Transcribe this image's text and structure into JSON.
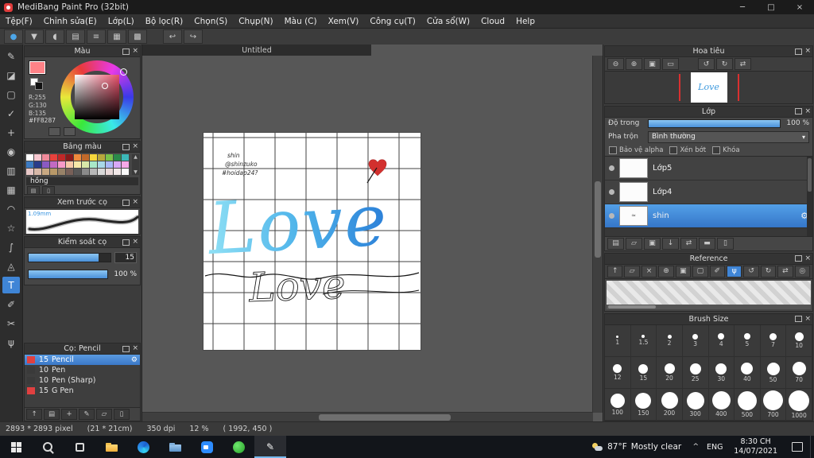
{
  "titlebar": {
    "title": "MediBang Paint Pro (32bit)",
    "minimize": "─",
    "maximize": "□",
    "close": "×"
  },
  "menubar": {
    "items": [
      "Tệp(F)",
      "Chỉnh sửa(E)",
      "Lớp(L)",
      "Bộ lọc(R)",
      "Chọn(S)",
      "Chụp(N)",
      "Màu (C)",
      "Xem(V)",
      "Công cụ(T)",
      "Cửa sổ(W)",
      "Cloud",
      "Help"
    ]
  },
  "toolbar": {
    "icons": [
      {
        "name": "brush-dot-icon",
        "glyph": "●",
        "color": "#4da6e8"
      },
      {
        "name": "save-icon",
        "glyph": "▼"
      },
      {
        "name": "comment-icon",
        "glyph": "◖"
      },
      {
        "name": "material-panel-icon",
        "glyph": "▤"
      },
      {
        "name": "list-view-icon",
        "glyph": "≡"
      },
      {
        "name": "grid-view-icon",
        "glyph": "▦"
      },
      {
        "name": "table-view-icon",
        "glyph": "▩"
      }
    ],
    "undo_glyph": "↩",
    "redo_glyph": "↪"
  },
  "toolstrip": {
    "tools": [
      {
        "name": "brush-tool",
        "glyph": "✎",
        "active": false
      },
      {
        "name": "eraser-tool",
        "glyph": "◪",
        "active": false
      },
      {
        "name": "select-rect-tool",
        "glyph": "▢",
        "active": false
      },
      {
        "name": "select-pen-tool",
        "glyph": "✓",
        "active": false
      },
      {
        "name": "move-tool",
        "glyph": "+",
        "active": false
      },
      {
        "name": "bucket-tool",
        "glyph": "◉",
        "active": false
      },
      {
        "name": "gradient-tool",
        "glyph": "▥",
        "active": false
      },
      {
        "name": "marquee-tool",
        "glyph": "▦",
        "active": false
      },
      {
        "name": "lasso-tool",
        "glyph": "◠",
        "active": false
      },
      {
        "name": "magic-wand-tool",
        "glyph": "☆",
        "active": false
      },
      {
        "name": "curve-tool",
        "glyph": "∫",
        "active": false
      },
      {
        "name": "shape-tool",
        "glyph": "◬",
        "active": false
      },
      {
        "name": "text-tool",
        "glyph": "T",
        "active": true
      },
      {
        "name": "pipette-tool",
        "glyph": "✐",
        "active": false
      },
      {
        "name": "divide-tool",
        "glyph": "✂",
        "active": false
      },
      {
        "name": "hand-tool",
        "glyph": "ψ",
        "active": false
      }
    ]
  },
  "color_panel": {
    "title": "Màu",
    "r_label": "R:255",
    "g_label": "G:130",
    "b_label": "B:135",
    "hex": "#FF8287",
    "fg_color": "#FF8287"
  },
  "palette_panel": {
    "title": "Bảng màu",
    "selected_name": "hồng",
    "up": "▲",
    "down": "▼",
    "colors": [
      "#ffffff",
      "#f7c8d0",
      "#f08a9a",
      "#e8413c",
      "#c22828",
      "#8a1a1a",
      "#f08a3c",
      "#c2692a",
      "#f7d83c",
      "#b8a83c",
      "#7ac24a",
      "#2a8a4a",
      "#3cb8b8",
      "#3c7ac2",
      "#2a3c8a",
      "#8a5ac2",
      "#c26ac2",
      "#f79ac8",
      "#f7c8a8",
      "#f7e8a8",
      "#d8e8a8",
      "#a8e8c8",
      "#a8d8e8",
      "#a8b8f7",
      "#d8a8f7",
      "#f7a8e8",
      "#e8c8c8",
      "#d8b8a8",
      "#c8a882",
      "#b89868",
      "#988268",
      "#786058",
      "#585858",
      "#8a8a8a",
      "#b8b8b8",
      "#d8d8d8",
      "#e8d8d8",
      "#f2e8e8",
      "#fafafa"
    ]
  },
  "brush_preview_panel": {
    "title": "Xem trước cọ",
    "size_label": "1.09mm"
  },
  "brush_control_panel": {
    "title": "Kiểm soát cọ",
    "size_value": "15",
    "size_fill": "85%",
    "opacity_value": "100 %",
    "opacity_fill": "100%"
  },
  "brush_list_panel": {
    "title": "Cọ: Pencil",
    "gear_glyph": "⚙",
    "brushes": [
      {
        "size": "15",
        "name": "Pencil",
        "chip": "#e04040",
        "selected": true
      },
      {
        "size": "10",
        "name": "Pen",
        "chip": "#3a3a3a",
        "selected": false
      },
      {
        "size": "10",
        "name": "Pen (Sharp)",
        "chip": "#3a3a3a",
        "selected": false
      },
      {
        "size": "15",
        "name": "G Pen",
        "chip": "#e04040",
        "selected": false
      }
    ],
    "footer_icons": [
      {
        "name": "scroll-up-icon",
        "glyph": "↑"
      },
      {
        "name": "new-brush-icon",
        "glyph": "▤"
      },
      {
        "name": "add-brush-icon",
        "glyph": "+"
      },
      {
        "name": "edit-brush-icon",
        "glyph": "✎"
      },
      {
        "name": "brush-folder-icon",
        "glyph": "▱"
      },
      {
        "name": "delete-brush-icon",
        "glyph": "▯"
      }
    ]
  },
  "canvas": {
    "tab": "Untitled",
    "note_line1": "shin",
    "note_line2": "@shinzuko",
    "note_line3": "#hoidap24?",
    "word_main": "Love",
    "word_script": "Love"
  },
  "navigator_panel": {
    "title": "Hoa tiêu",
    "icons": [
      {
        "name": "nav-zoom-out-icon",
        "glyph": "⊖"
      },
      {
        "name": "nav-zoom-in-icon",
        "glyph": "⊕"
      },
      {
        "name": "nav-fit-icon",
        "glyph": "▣"
      },
      {
        "name": "nav-actual-size-icon",
        "glyph": "▭"
      },
      {
        "name": "nav-rotate-left-icon",
        "glyph": "↺"
      },
      {
        "name": "nav-rotate-right-icon",
        "glyph": "↻"
      },
      {
        "name": "nav-flip-icon",
        "glyph": "⇄"
      }
    ]
  },
  "layers_panel": {
    "title": "Lớp",
    "opacity_label": "Độ trong",
    "opacity_value": "100 %",
    "opacity_fill": "100%",
    "blend_label": "Pha trộn",
    "blend_value": "Bình thường",
    "blend_arrow": "▾",
    "alpha_check": "Bảo vệ alpha",
    "clip_check": "Xén bớt",
    "lock_check": "Khóa",
    "gear_glyph": "⚙",
    "layers": [
      {
        "name": "Lớp5",
        "selected": false
      },
      {
        "name": "Lớp4",
        "selected": false
      },
      {
        "name": "shin",
        "selected": true,
        "thumb_text": "≈"
      }
    ],
    "footer_icons": [
      {
        "name": "layer-new-icon",
        "glyph": "▤"
      },
      {
        "name": "layer-folder-icon",
        "glyph": "▱"
      },
      {
        "name": "layer-duplicate-icon",
        "glyph": "▣"
      },
      {
        "name": "layer-down-icon",
        "glyph": "↓"
      },
      {
        "name": "layer-transfer-icon",
        "glyph": "⇄"
      },
      {
        "name": "layer-merge-icon",
        "glyph": "▬"
      },
      {
        "name": "layer-trash-icon",
        "glyph": "▯"
      }
    ]
  },
  "reference_panel": {
    "title": "Reference",
    "icons": [
      {
        "name": "ref-up-icon",
        "glyph": "↑",
        "active": false
      },
      {
        "name": "ref-folder-icon",
        "glyph": "▱",
        "active": false
      },
      {
        "name": "ref-close-icon",
        "glyph": "×",
        "active": false
      },
      {
        "name": "ref-zoom-in-icon",
        "glyph": "⊕",
        "active": false
      },
      {
        "name": "ref-fit-icon",
        "glyph": "▣",
        "active": false
      },
      {
        "name": "ref-crop-icon",
        "glyph": "▢",
        "active": false
      },
      {
        "name": "ref-pipette-icon",
        "glyph": "✐",
        "active": false
      },
      {
        "name": "ref-hand-icon",
        "glyph": "ψ",
        "active": true
      },
      {
        "name": "ref-rotate-left-icon",
        "glyph": "↺",
        "active": false
      },
      {
        "name": "ref-rotate-right-icon",
        "glyph": "↻",
        "active": false
      },
      {
        "name": "ref-flip-icon",
        "glyph": "⇄",
        "active": false
      },
      {
        "name": "ref-reset-icon",
        "glyph": "◎",
        "active": false
      }
    ]
  },
  "brush_size_panel": {
    "title": "Brush Size",
    "sizes": [
      "1",
      "1.5",
      "2",
      "3",
      "4",
      "5",
      "7",
      "10",
      "12",
      "15",
      "20",
      "25",
      "30",
      "40",
      "50",
      "70",
      "100",
      "150",
      "200",
      "300",
      "400",
      "500",
      "700",
      "1000"
    ]
  },
  "statusbar": {
    "segments": [
      "2893 * 2893 pixel",
      "(21 * 21cm)",
      "350 dpi",
      "12 %",
      "( 1992, 450 )"
    ]
  },
  "taskbar": {
    "apps": [
      {
        "name": "start",
        "active": false
      },
      {
        "name": "search",
        "active": false
      },
      {
        "name": "task-view",
        "active": false
      },
      {
        "name": "file-explorer",
        "active": false
      },
      {
        "name": "edge",
        "active": false
      },
      {
        "name": "folder",
        "active": false
      },
      {
        "name": "zoom",
        "active": false
      },
      {
        "name": "green-app",
        "active": false
      },
      {
        "name": "medibang",
        "active": true
      }
    ],
    "weather_temp": "87°F",
    "weather_desc": "Mostly clear",
    "chevron": "^",
    "lang": "ENG",
    "time": "8:30 CH",
    "date": "14/07/2021"
  }
}
